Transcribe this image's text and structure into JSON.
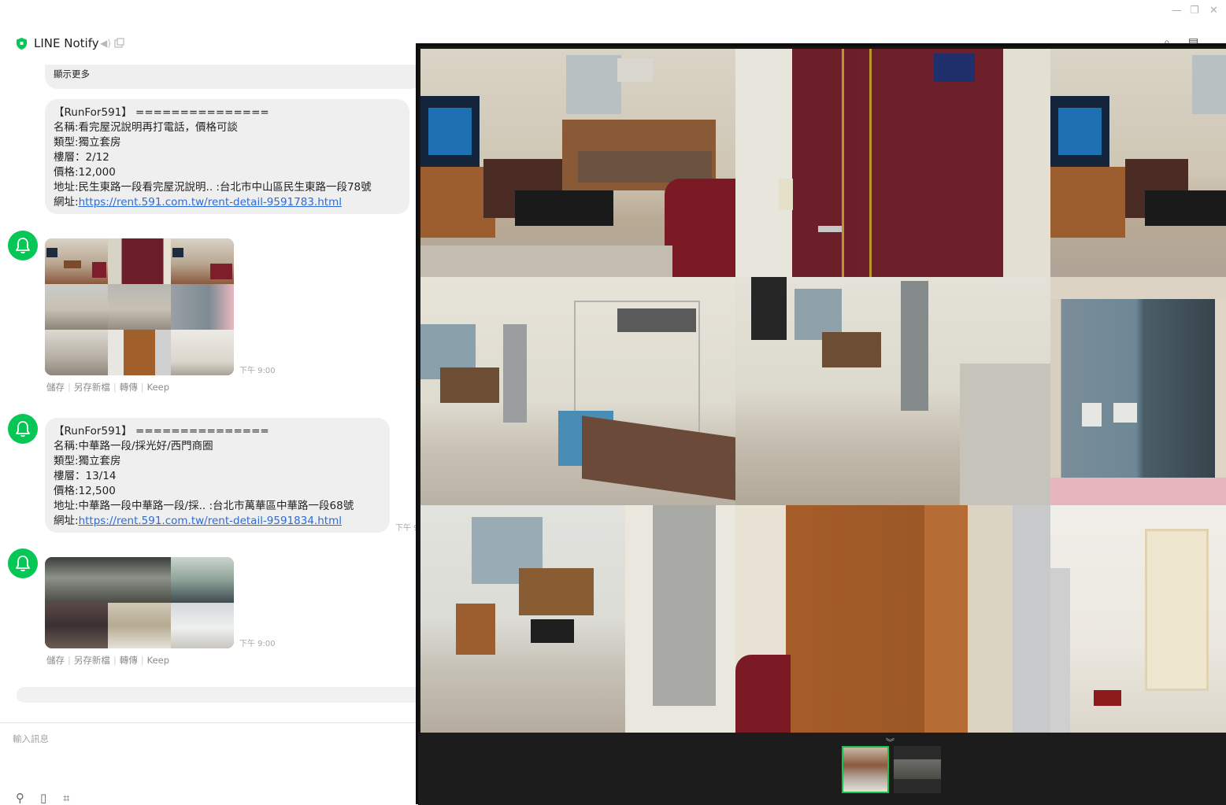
{
  "title_bar": {
    "title": "LINE Notify",
    "minimize": "—",
    "restore": "❐",
    "close": "✕"
  },
  "colors": {
    "accent": "#06c755",
    "bubble": "#efefef",
    "link": "#2d6bd6",
    "viewer_bg": "#151515",
    "thumb_selected": "#16c24a"
  },
  "messages": {
    "show_more": "顯示更多",
    "listing1": {
      "header": "【RunFor591】 ===============",
      "name": "名稱:看完屋況說明再打電話，價格可談",
      "type": "類型:獨立套房",
      "floor": "樓層：2/12",
      "price": "價格:12,000",
      "address": "地址:民生東路一段看完屋況說明.. :台北市中山區民生東路一段78號",
      "url_label": "網址:",
      "url": "https://rent.591.com.tw/rent-detail-9591783.html"
    },
    "photo1": {
      "time": "下午 9:00"
    },
    "listing2": {
      "header": "【RunFor591】 ===============",
      "name": "名稱:中華路一段/採光好/西門商圈",
      "type": "類型:獨立套房",
      "floor": "樓層：13/14",
      "price": "價格:12,500",
      "address": "地址:中華路一段中華路一段/採.. :台北市萬華區中華路一段68號",
      "url_label": "網址:",
      "url": "https://rent.591.com.tw/rent-detail-9591834.html",
      "time": "下午 9"
    },
    "photo2": {
      "time": "下午 9:00"
    },
    "actions": {
      "save": "儲存",
      "save_as": "另存新檔",
      "forward": "轉傳",
      "keep": "Keep"
    }
  },
  "input": {
    "placeholder": "輸入訊息"
  },
  "icons": {
    "title": "line-notify-shield-icon",
    "mute": "speaker-mute-icon",
    "popout": "popout-window-icon",
    "bell": "bell-icon",
    "collapse": "chevron-double-down-icon",
    "search": "search-icon",
    "note": "note-icon",
    "attach": "paperclip-icon",
    "file": "file-icon",
    "crop": "screen-capture-icon"
  }
}
